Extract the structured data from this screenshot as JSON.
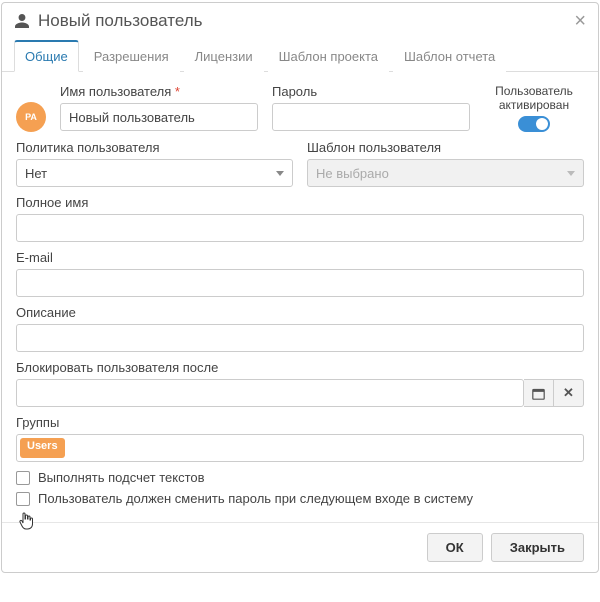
{
  "header": {
    "title": "Новый пользователь"
  },
  "tabs": [
    "Общие",
    "Разрешения",
    "Лицензии",
    "Шаблон проекта",
    "Шаблон отчета"
  ],
  "avatar_initials": "PA",
  "fields": {
    "username_label": "Имя пользователя",
    "username_value": "Новый пользователь",
    "password_label": "Пароль",
    "password_value": "",
    "activated_label": "Пользователь активирован",
    "activated_on": true,
    "policy_label": "Политика пользователя",
    "policy_value": "Нет",
    "template_label": "Шаблон пользователя",
    "template_value": "Не выбрано",
    "fullname_label": "Полное имя",
    "fullname_value": "",
    "email_label": "E-mail",
    "email_value": "",
    "description_label": "Описание",
    "description_value": "",
    "lockafter_label": "Блокировать пользователя после",
    "lockafter_value": "",
    "groups_label": "Группы",
    "groups_tags": [
      "Users"
    ],
    "checkbox1": "Выполнять подсчет текстов",
    "checkbox2": "Пользователь должен сменить пароль при следующем входе в систему"
  },
  "footer": {
    "ok": "ОК",
    "close": "Закрыть"
  }
}
